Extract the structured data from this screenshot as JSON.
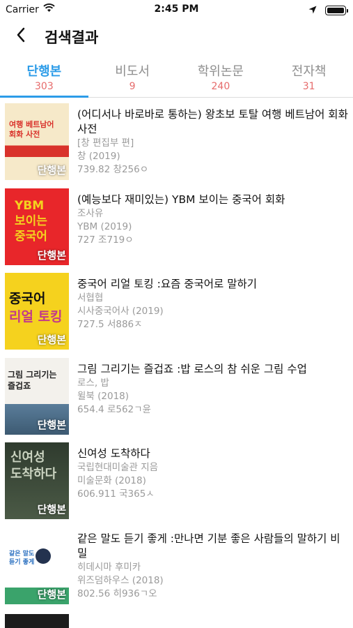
{
  "status_bar": {
    "carrier": "Carrier",
    "time": "2:45 PM"
  },
  "nav": {
    "title": "검색결과",
    "back_icon": "chevron-left-icon"
  },
  "tabs": [
    {
      "label": "단행본",
      "count": "303",
      "active": true
    },
    {
      "label": "비도서",
      "count": "9",
      "active": false
    },
    {
      "label": "학위논문",
      "count": "240",
      "active": false
    },
    {
      "label": "전자책",
      "count": "31",
      "active": false
    }
  ],
  "results": [
    {
      "title": "(어디서나 바로바로 통하는) 왕초보 토탈 여행 베트남어 회화 사전",
      "author": "[창 편집부 편]",
      "publisher": "창 (2019)",
      "call_number": "739.82 창256ㅇ",
      "badge": "단행본",
      "cover_colors": [
        "#f6e9c9",
        "#d9322b"
      ],
      "cover_text": "여행 베트남어\n회화 사전"
    },
    {
      "title": "(예능보다 재미있는) YBM 보이는 중국어 회화",
      "author": "조사유",
      "publisher": "YBM (2019)",
      "call_number": "727 조719ㅇ",
      "badge": "단행본",
      "cover_colors": [
        "#e8262a",
        "#f4d21f"
      ],
      "cover_text": "YBM\n보이는\n중국어"
    },
    {
      "title": "중국어 리얼 토킹 :요즘 중국어로 말하기",
      "author": "서협협",
      "publisher": "시사중국어사 (2019)",
      "call_number": "727.5 서886ㅈ",
      "badge": "단행본",
      "cover_colors": [
        "#f5d21e",
        "#c23a8a"
      ],
      "cover_text": "중국어\n리얼 토킹"
    },
    {
      "title": "그림 그리기는 즐겁죠 :밥 로스의 참 쉬운 그림 수업",
      "author": "로스, 밥",
      "publisher": "윌북 (2018)",
      "call_number": "654.4 로562ㄱ윤",
      "badge": "단행본",
      "cover_colors": [
        "#f3f1ec",
        "#5a7d9a"
      ],
      "cover_text": "그림 그리기는\n즐겁죠"
    },
    {
      "title": "신여성 도착하다",
      "author": "국립현대미술관 지음",
      "publisher": "미술문화 (2018)",
      "call_number": "606.911 국365ㅅ",
      "badge": "단행본",
      "cover_colors": [
        "#2f3b2e",
        "#6f7a62"
      ],
      "cover_text": "신여성\n도착하다"
    },
    {
      "title": "같은 말도 듣기 좋게 :만나면 기분 좋은 사람들의 말하기 비밀",
      "author": "히데시마 후미카",
      "publisher": "위즈덤하우스 (2018)",
      "call_number": "802.56 히936ㄱ오",
      "badge": "단행본",
      "cover_colors": [
        "#ffffff",
        "#3aa36b"
      ],
      "cover_text": "같은 말도\n듣기 좋게"
    }
  ]
}
